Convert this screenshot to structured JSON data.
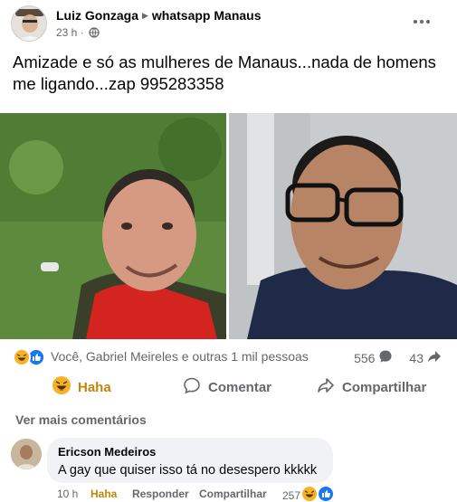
{
  "post": {
    "author": "Luiz Gonzaga",
    "group": "whatsapp Manaus",
    "time": "23 h ·",
    "text": "Amizade e só as mulheres de Manaus...nada de homens me ligando...zap 995283358"
  },
  "reactions": {
    "summary": "Você, Gabriel Meireles e outras 1 mil pessoas",
    "comments_count": "556",
    "shares_count": "43"
  },
  "actions": {
    "haha": "Haha",
    "comment": "Comentar",
    "share": "Compartilhar"
  },
  "comments": {
    "see_more": "Ver mais comentários",
    "items": [
      {
        "author": "Ericson Medeiros",
        "text": "A gay que quiser isso tá no desespero kkkkk",
        "time": "10 h",
        "reaction_label": "Haha",
        "reply": "Responder",
        "share": "Compartilhar",
        "reaction_count": "257"
      }
    ]
  },
  "colors": {
    "haha": "#c0860a",
    "like": "#1877f2",
    "muted": "#65676b",
    "bubble": "#f0f2f5"
  },
  "icons": [
    "more-icon",
    "globe-icon",
    "haha-icon",
    "like-icon",
    "comment-icon",
    "share-icon",
    "caret-right-icon"
  ]
}
